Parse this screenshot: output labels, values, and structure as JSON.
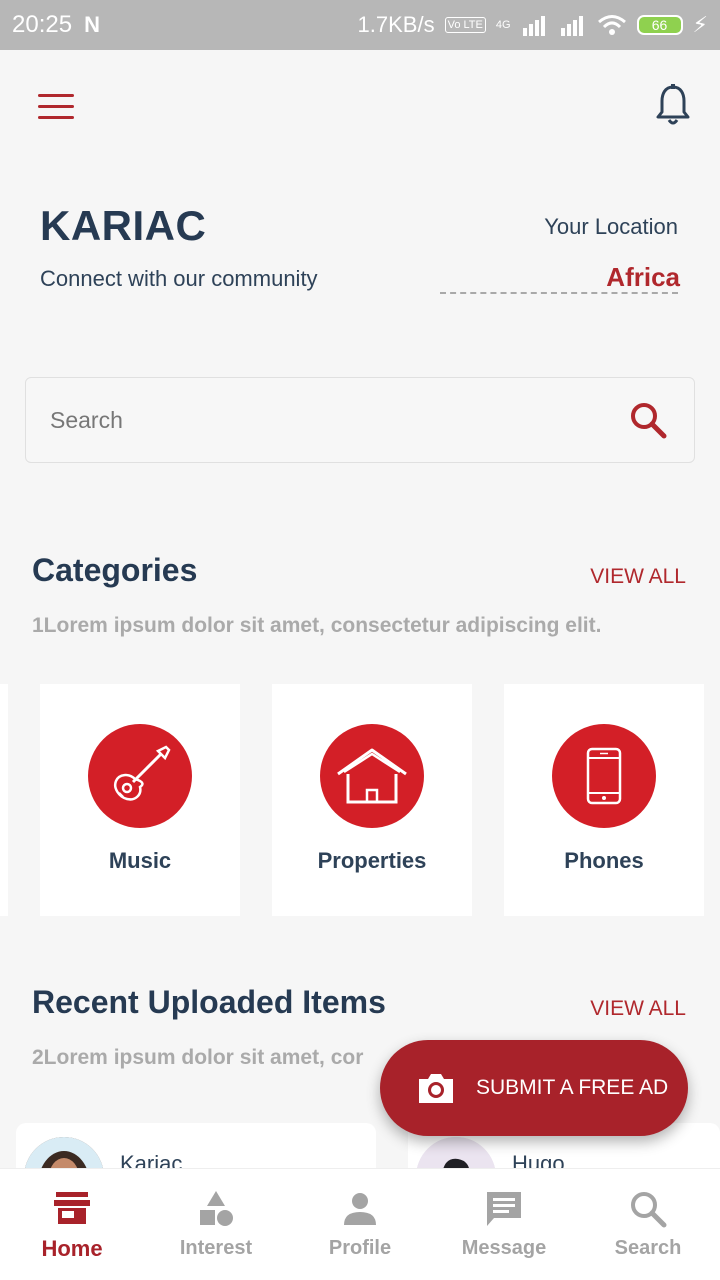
{
  "status_bar": {
    "time": "20:25",
    "net_speed": "1.7KB/s",
    "volte": "Vo LTE",
    "network": "4G",
    "battery": "66"
  },
  "header": {
    "brand": "KARIAC",
    "tagline": "Connect with our community",
    "location_label": "Your Location",
    "location_value": "Africa"
  },
  "search": {
    "placeholder": "Search"
  },
  "categories": {
    "title": "Categories",
    "view_all": "VIEW ALL",
    "subtitle": "1Lorem ipsum dolor sit amet, consectetur adipiscing elit.",
    "items": [
      {
        "label": "Music",
        "icon": "guitar-icon"
      },
      {
        "label": "Properties",
        "icon": "house-icon"
      },
      {
        "label": "Phones",
        "icon": "phone-icon"
      }
    ]
  },
  "recent": {
    "title": "Recent Uploaded Items",
    "view_all": "VIEW ALL",
    "subtitle": "2Lorem ipsum dolor sit amet, cor",
    "items": [
      {
        "name": "Kariac"
      },
      {
        "name": "Hugo"
      }
    ]
  },
  "fab": {
    "label": "SUBMIT A FREE AD"
  },
  "bottom_nav": {
    "items": [
      {
        "label": "Home",
        "icon": "store-icon",
        "active": true
      },
      {
        "label": "Interest",
        "icon": "shapes-icon"
      },
      {
        "label": "Profile",
        "icon": "person-icon"
      },
      {
        "label": "Message",
        "icon": "chat-icon"
      },
      {
        "label": "Search",
        "icon": "search-icon"
      }
    ]
  },
  "colors": {
    "accent": "#b0282d",
    "category_circle": "#d31f27",
    "fab": "#a8222a",
    "heading": "#263a52"
  }
}
